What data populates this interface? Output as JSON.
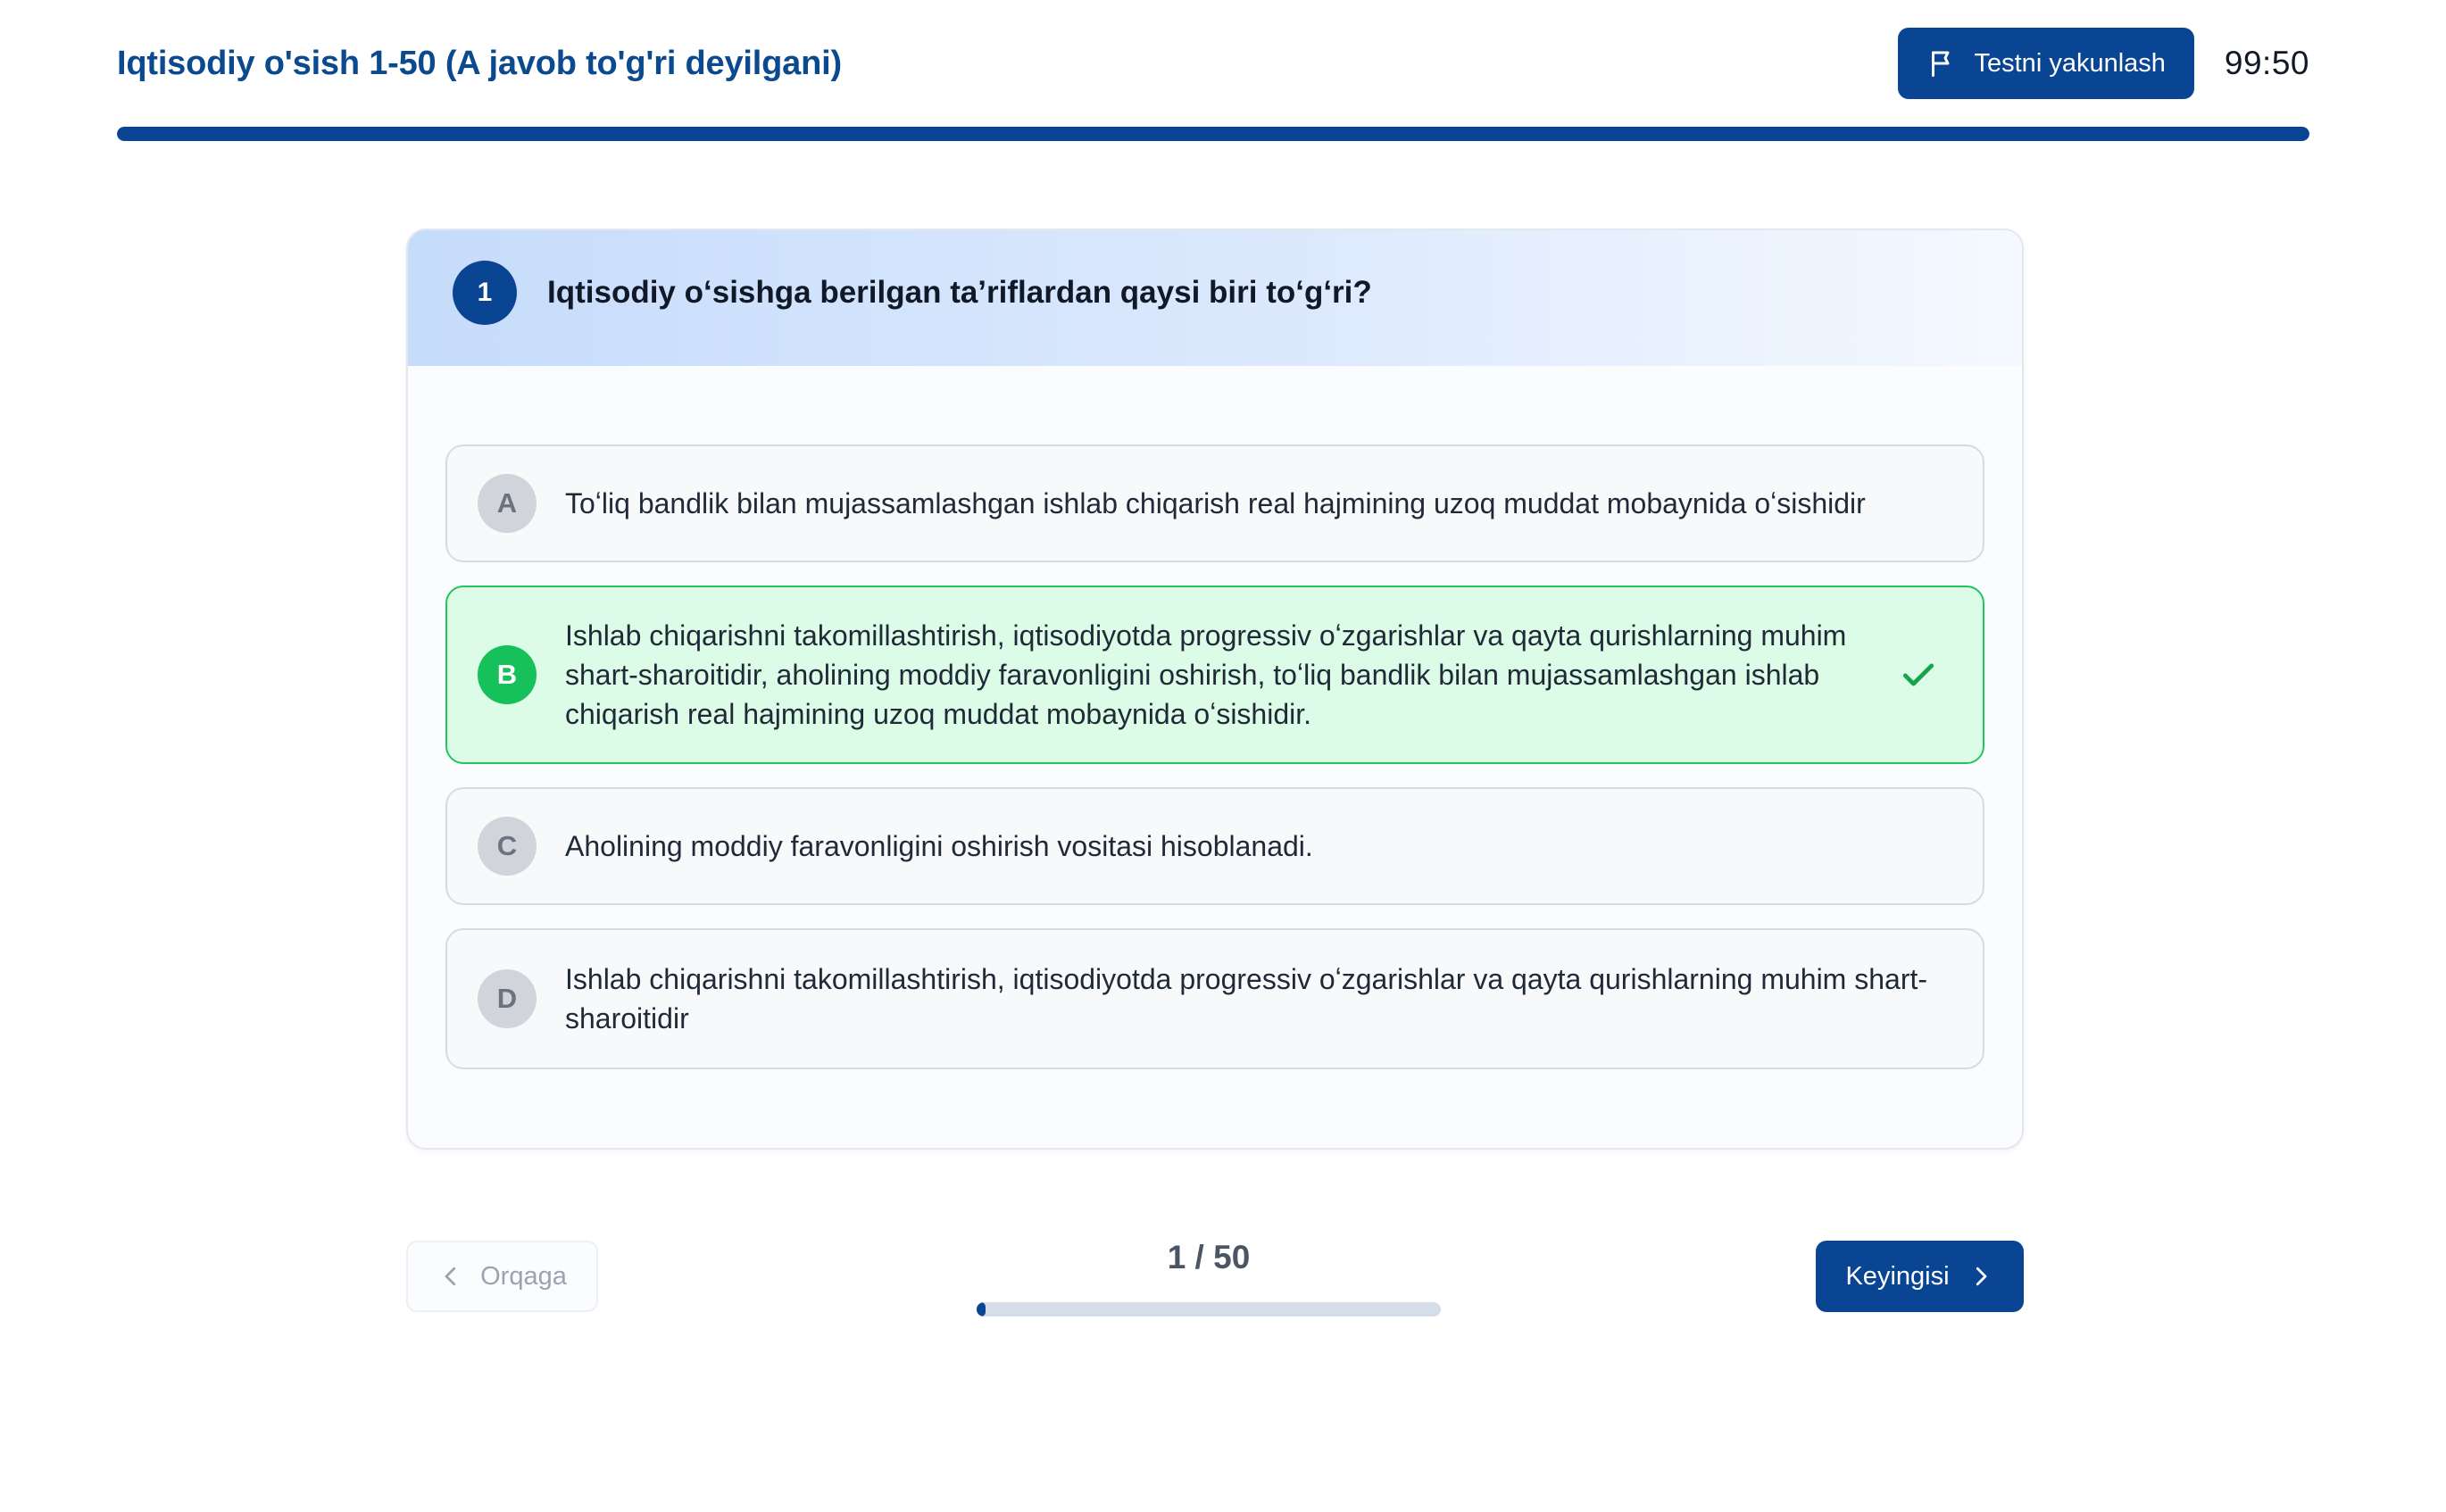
{
  "header": {
    "title": "Iqtisodiy o'sish 1-50 (A javob to'g'ri deyilgani)",
    "finish_label": "Testni yakunlash",
    "finish_icon": "flag-icon",
    "timer": "99:50"
  },
  "progress": {
    "top_fraction": 1.0,
    "bottom_fraction": 0.02,
    "accent_color": "#0a4593"
  },
  "question": {
    "number": "1",
    "text": "Iqtisodiy oʻsishga berilgan taʼriflardan qaysi biri toʻgʻri?"
  },
  "options": [
    {
      "letter": "A",
      "text": "Toʻliq bandlik bilan mujassamlashgan ishlab chiqarish real hajmining uzoq muddat mobaynida oʻsishidir",
      "correct": false
    },
    {
      "letter": "B",
      "text": "Ishlab chiqarishni takomillashtirish, iqtisodiyotda progressiv oʻzgarishlar va qayta qurishlarning muhim shart-sharoitidir, aholining moddiy faravonligini oshirish, toʻliq bandlik bilan mujassamlashgan ishlab chiqarish real hajmining uzoq muddat mobaynida oʻsishidir.",
      "correct": true,
      "icon": "check-icon",
      "color": "#22c55e"
    },
    {
      "letter": "C",
      "text": "Aholining moddiy faravonligini oshirish vositasi hisoblanadi.",
      "correct": false
    },
    {
      "letter": "D",
      "text": "Ishlab chiqarishni takomillashtirish, iqtisodiyotda progressiv oʻzgarishlar va qayta qurishlarning muhim shart-sharoitidir",
      "correct": false
    }
  ],
  "nav": {
    "back_label": "Orqaga",
    "back_icon": "chevron-left-icon",
    "next_label": "Keyingisi",
    "next_icon": "chevron-right-icon",
    "counter": "1 / 50"
  }
}
